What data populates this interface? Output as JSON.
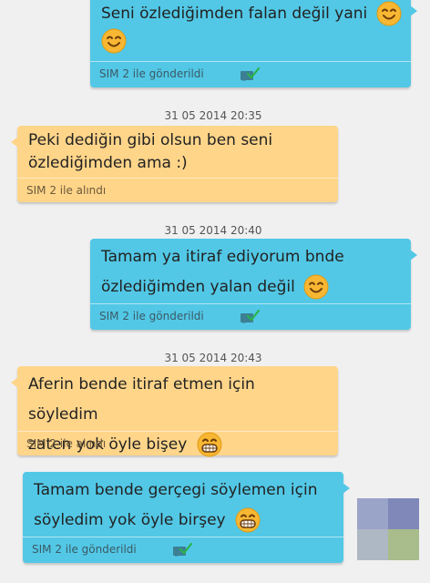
{
  "messages": [
    {
      "type": "sent",
      "lines": [
        "Seni özlediğimden falan değil yani",
        ""
      ],
      "meta": "SIM 2 ile gönderildi"
    },
    {
      "type": "recv",
      "time": "31 05 2014 20:35",
      "lines": [
        "Peki dediğin gibi olsun ben seni",
        "özlediğimden ama :)"
      ],
      "meta": "SIM 2 ile alındı"
    },
    {
      "type": "sent",
      "time": "31 05 2014 20:40",
      "lines": [
        "Tamam ya itiraf ediyorum bnde",
        "özlediğimden yalan değil"
      ],
      "meta": "SIM 2 ile gönderildi"
    },
    {
      "type": "recv",
      "time": "31 05 2014 20:43",
      "lines": [
        "Aferin bende itiraf etmen için söyledim",
        "zaten yok öyle bişey"
      ],
      "meta": "SIM 2 ile alındı"
    },
    {
      "type": "sent",
      "lines": [
        "Tamam bende gerçegi söylemen için",
        "söyledim yok öyle birşey"
      ],
      "meta": "SIM 2 ile gönderildi"
    }
  ],
  "icons": {
    "smile": "smiling-face-icon",
    "grin": "grinning-face-icon",
    "delivered": "delivered-check-icon"
  },
  "colors": {
    "sent_bubble": "#52c8e6",
    "received_bubble": "#ffd58a",
    "background": "#f0f0f0"
  }
}
